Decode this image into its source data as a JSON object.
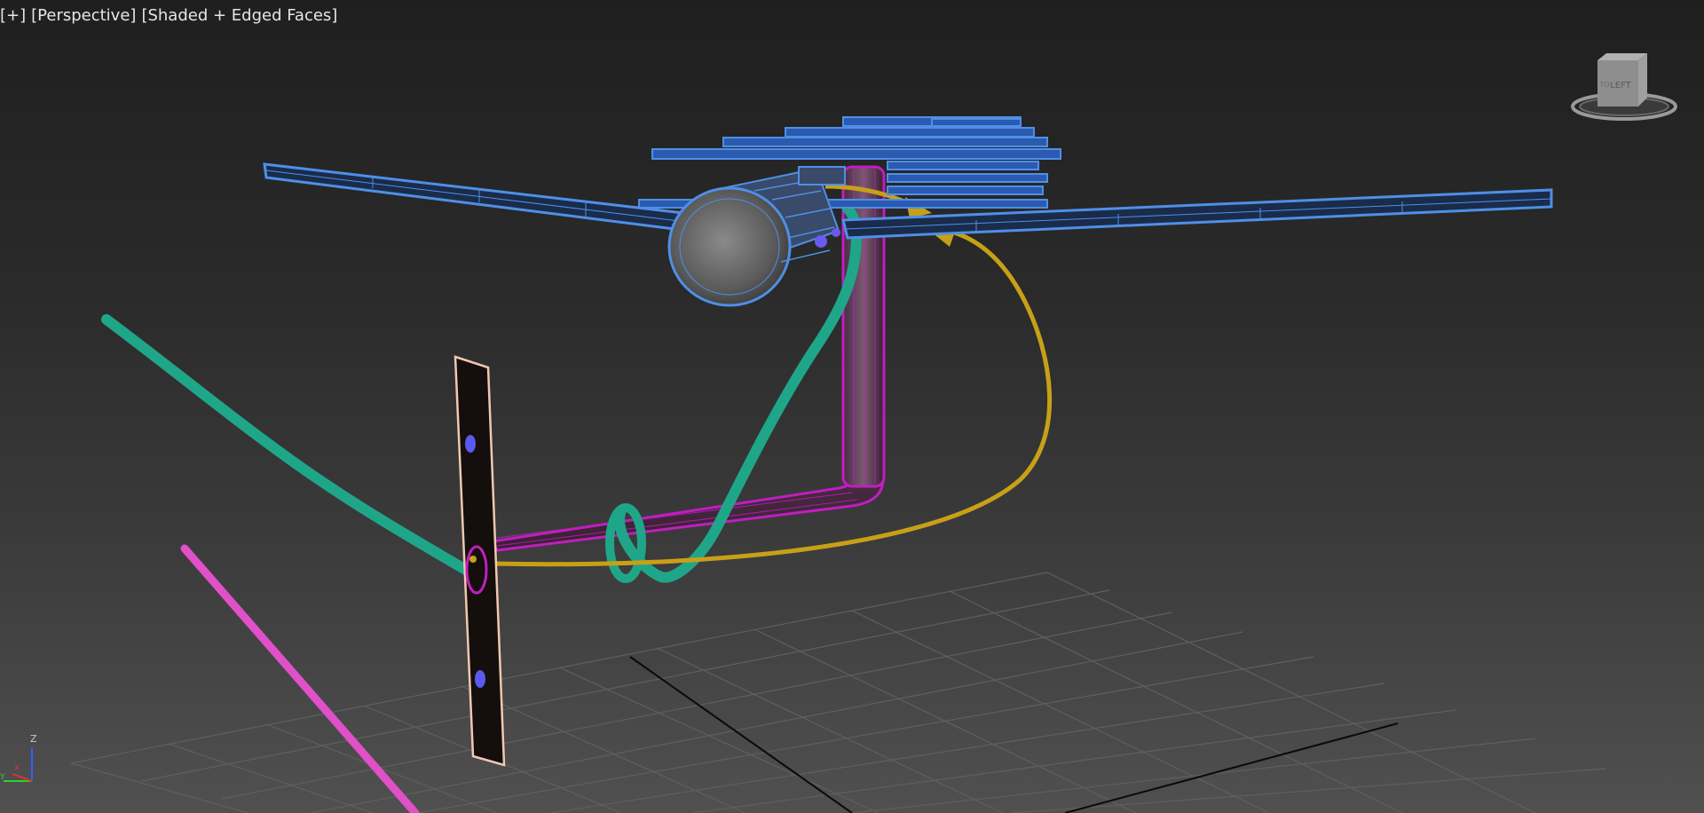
{
  "viewport": {
    "label_plus": "[+]",
    "label_view": "[Perspective]",
    "label_shading": "[Shaded + Edged Faces]"
  },
  "viewcube": {
    "face_label": "LEFT",
    "side_label": "TO"
  },
  "axis_gizmo": {
    "z_label": "Z",
    "x_label": "X",
    "y_label": "Y"
  },
  "colors": {
    "background_top": "#1f1f1f",
    "background_bottom": "#505050",
    "grid": "#5c5c5c",
    "blade_wireframe": "#4f8fe6",
    "blade_fill": "#2a5bb0",
    "pipe": "#c01ec0",
    "green_cable": "#1fa688",
    "pink_cable": "#e050c8",
    "yellow_curve": "#c8a018",
    "post_outline": "#f0c8b0"
  }
}
